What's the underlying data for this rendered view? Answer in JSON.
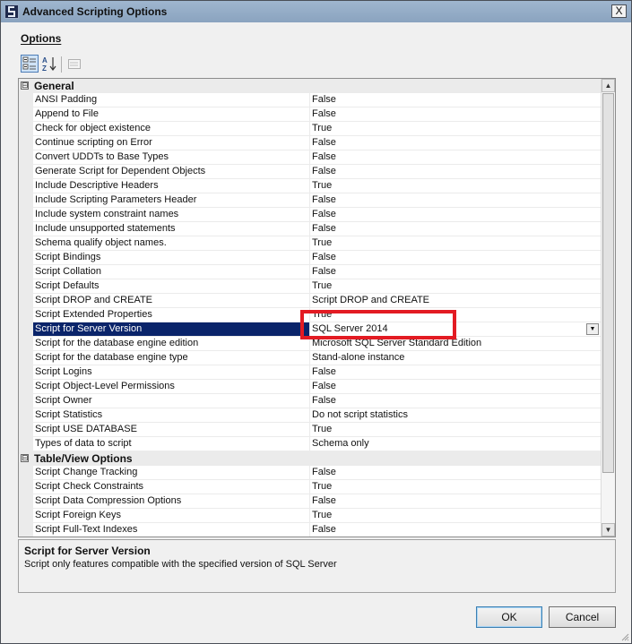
{
  "window": {
    "title": "Advanced Scripting Options",
    "close_glyph": "X"
  },
  "options_label": "Options",
  "toolbar": {
    "categorized_icon": "categorized-icon",
    "alphabetical_icon": "sort-az-icon",
    "property_pages_icon": "property-pages-icon"
  },
  "grid": {
    "categories": [
      {
        "name": "General",
        "toggle": "⊟",
        "rows": [
          {
            "name": "ANSI Padding",
            "value": "False"
          },
          {
            "name": "Append to File",
            "value": "False"
          },
          {
            "name": "Check for object existence",
            "value": "True"
          },
          {
            "name": "Continue scripting on Error",
            "value": "False"
          },
          {
            "name": "Convert UDDTs to Base Types",
            "value": "False"
          },
          {
            "name": "Generate Script for Dependent Objects",
            "value": "False"
          },
          {
            "name": "Include Descriptive Headers",
            "value": "True"
          },
          {
            "name": "Include Scripting Parameters Header",
            "value": "False"
          },
          {
            "name": "Include system constraint names",
            "value": "False"
          },
          {
            "name": "Include unsupported statements",
            "value": "False"
          },
          {
            "name": "Schema qualify object names.",
            "value": "True"
          },
          {
            "name": "Script Bindings",
            "value": "False"
          },
          {
            "name": "Script Collation",
            "value": "False"
          },
          {
            "name": "Script Defaults",
            "value": "True"
          },
          {
            "name": "Script DROP and CREATE",
            "value": "Script DROP and CREATE"
          },
          {
            "name": "Script Extended Properties",
            "value": "True"
          },
          {
            "name": "Script for Server Version",
            "value": "SQL Server 2014"
          },
          {
            "name": "Script for the database engine edition",
            "value": "Microsoft SQL Server Standard Edition"
          },
          {
            "name": "Script for the database engine type",
            "value": "Stand-alone instance"
          },
          {
            "name": "Script Logins",
            "value": "False"
          },
          {
            "name": "Script Object-Level Permissions",
            "value": "False"
          },
          {
            "name": "Script Owner",
            "value": "False"
          },
          {
            "name": "Script Statistics",
            "value": "Do not script statistics"
          },
          {
            "name": "Script USE DATABASE",
            "value": "True"
          },
          {
            "name": "Types of data to script",
            "value": "Schema only"
          }
        ]
      },
      {
        "name": "Table/View Options",
        "toggle": "⊟",
        "rows": [
          {
            "name": "Script Change Tracking",
            "value": "False"
          },
          {
            "name": "Script Check Constraints",
            "value": "True"
          },
          {
            "name": "Script Data Compression Options",
            "value": "False"
          },
          {
            "name": "Script Foreign Keys",
            "value": "True"
          },
          {
            "name": "Script Full-Text Indexes",
            "value": "False"
          }
        ]
      }
    ],
    "selected_row": "Script for Server Version",
    "highlight_color": "#e31b23",
    "selection_color": "#0a246a"
  },
  "description": {
    "title": "Script for Server Version",
    "text": "Script only features compatible with the specified version of SQL Server"
  },
  "buttons": {
    "ok": "OK",
    "cancel": "Cancel"
  }
}
